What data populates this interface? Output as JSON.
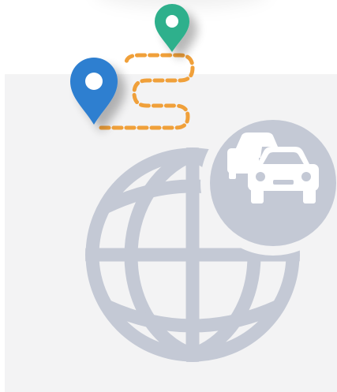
{
  "illustration": {
    "route_icon": "route-map-pins-icon",
    "globe_icon": "globe-icon",
    "traffic_icon": "traffic-cars-icon",
    "start_pin_icon": "map-pin-blue-icon",
    "end_pin_icon": "map-pin-green-icon"
  },
  "colors": {
    "background": "#ffffff",
    "panel": "#f3f3f4",
    "globe": "#c4c9d5",
    "traffic_badge": "#c4c9d5",
    "cars": "#ffffff",
    "route_dashes": "#f0a03a",
    "pin_blue": "#2f7fd0",
    "pin_green": "#2fb08c"
  }
}
